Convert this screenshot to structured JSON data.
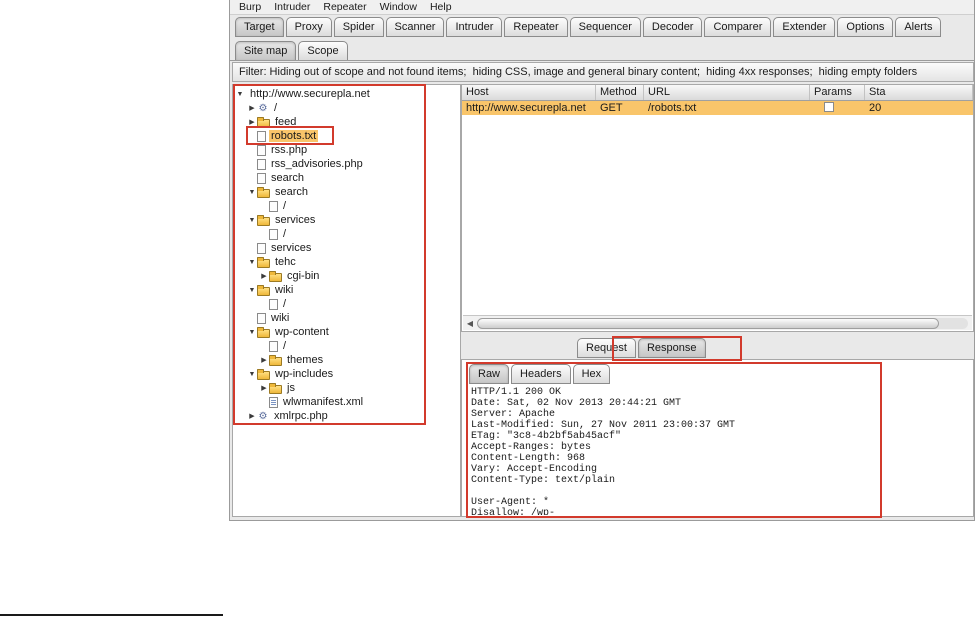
{
  "menubar": {
    "items": [
      "Burp",
      "Intruder",
      "Repeater",
      "Window",
      "Help"
    ]
  },
  "main_tabs": {
    "items": [
      "Target",
      "Proxy",
      "Spider",
      "Scanner",
      "Intruder",
      "Repeater",
      "Sequencer",
      "Decoder",
      "Comparer",
      "Extender",
      "Options",
      "Alerts"
    ],
    "selected": "Target"
  },
  "sub_tabs": {
    "items": [
      "Site map",
      "Scope"
    ],
    "selected": "Site map"
  },
  "filter_bar": {
    "text": "Filter: Hiding out of scope and not found items;  hiding CSS, image and general binary content;  hiding 4xx responses;  hiding empty folders"
  },
  "icons": {
    "arrow_down": "▼",
    "arrow_right": "▶",
    "gear": "⚙",
    "scroll_left": "◀"
  },
  "site_tree": {
    "items": [
      {
        "level": 0,
        "arrow": "down",
        "icon": "none",
        "label": "http://www.securepla.net",
        "selected": false
      },
      {
        "level": 1,
        "arrow": "right",
        "icon": "gear",
        "label": "/",
        "selected": false
      },
      {
        "level": 1,
        "arrow": "right",
        "icon": "folder",
        "label": "feed",
        "selected": false
      },
      {
        "level": 1,
        "arrow": "none",
        "icon": "file",
        "label": "robots.txt",
        "selected": true
      },
      {
        "level": 1,
        "arrow": "none",
        "icon": "file",
        "label": "rss.php",
        "selected": false
      },
      {
        "level": 1,
        "arrow": "none",
        "icon": "file",
        "label": "rss_advisories.php",
        "selected": false
      },
      {
        "level": 1,
        "arrow": "none",
        "icon": "file",
        "label": "search",
        "selected": false
      },
      {
        "level": 1,
        "arrow": "down",
        "icon": "folder",
        "label": "search",
        "selected": false
      },
      {
        "level": 2,
        "arrow": "none",
        "icon": "file",
        "label": "/",
        "selected": false
      },
      {
        "level": 1,
        "arrow": "down",
        "icon": "folder",
        "label": "services",
        "selected": false
      },
      {
        "level": 2,
        "arrow": "none",
        "icon": "file",
        "label": "/",
        "selected": false
      },
      {
        "level": 1,
        "arrow": "none",
        "icon": "file",
        "label": "services",
        "selected": false
      },
      {
        "level": 1,
        "arrow": "down",
        "icon": "folder",
        "label": "tehc",
        "selected": false
      },
      {
        "level": 2,
        "arrow": "right",
        "icon": "folder",
        "label": "cgi-bin",
        "selected": false
      },
      {
        "level": 1,
        "arrow": "down",
        "icon": "folder",
        "label": "wiki",
        "selected": false
      },
      {
        "level": 2,
        "arrow": "none",
        "icon": "file",
        "label": "/",
        "selected": false
      },
      {
        "level": 1,
        "arrow": "none",
        "icon": "file",
        "label": "wiki",
        "selected": false
      },
      {
        "level": 1,
        "arrow": "down",
        "icon": "folder",
        "label": "wp-content",
        "selected": false
      },
      {
        "level": 2,
        "arrow": "none",
        "icon": "file",
        "label": "/",
        "selected": false
      },
      {
        "level": 2,
        "arrow": "right",
        "icon": "folder",
        "label": "themes",
        "selected": false
      },
      {
        "level": 1,
        "arrow": "down",
        "icon": "folder",
        "label": "wp-includes",
        "selected": false
      },
      {
        "level": 2,
        "arrow": "right",
        "icon": "folder",
        "label": "js",
        "selected": false
      },
      {
        "level": 2,
        "arrow": "none",
        "icon": "xml",
        "label": "wlwmanifest.xml",
        "selected": false
      },
      {
        "level": 1,
        "arrow": "right",
        "icon": "gear",
        "label": "xmlrpc.php",
        "selected": false
      }
    ]
  },
  "results_table": {
    "columns": [
      "Host",
      "Method",
      "URL",
      "Params",
      "Sta"
    ],
    "rows": [
      {
        "host": "http://www.securepla.net",
        "method": "GET",
        "url": "/robots.txt",
        "params_checked": false,
        "status": "20"
      }
    ]
  },
  "message_tabs": {
    "items": [
      "Request",
      "Response"
    ],
    "selected": "Response"
  },
  "view_tabs": {
    "items": [
      "Raw",
      "Headers",
      "Hex"
    ],
    "selected": "Raw"
  },
  "response": {
    "lines": [
      "HTTP/1.1 200 OK",
      "Date: Sat, 02 Nov 2013 20:44:21 GMT",
      "Server: Apache",
      "Last-Modified: Sun, 27 Nov 2011 23:00:37 GMT",
      "ETag: \"3c8-4b2bf5ab45acf\"",
      "Accept-Ranges: bytes",
      "Content-Length: 968",
      "Vary: Accept-Encoding",
      "Content-Type: text/plain",
      "",
      "User-Agent: *",
      "Disallow: /wp-"
    ]
  },
  "colors": {
    "selection_orange": "#f9c56a",
    "annotation_red": "#d23a2c",
    "folder_yellow": "#efb83a"
  }
}
